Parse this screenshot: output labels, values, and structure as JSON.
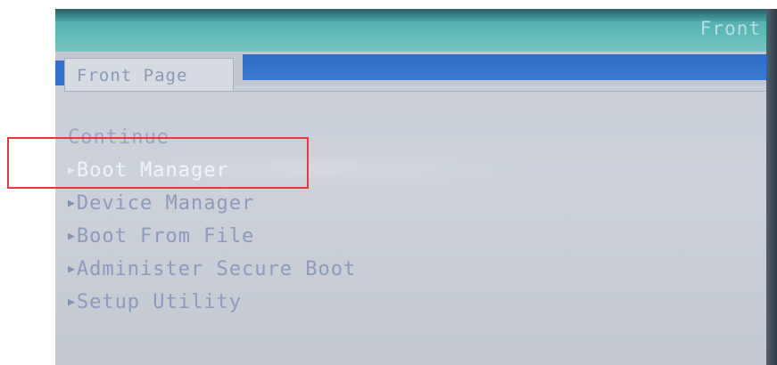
{
  "window": {
    "top_title": "Front"
  },
  "tabs": [
    {
      "label": "Front Page",
      "active": true
    }
  ],
  "menu": {
    "items": [
      {
        "label": "Continue",
        "has_arrow": false
      },
      {
        "label": "Boot Manager",
        "has_arrow": true,
        "selected": true
      },
      {
        "label": "Device Manager",
        "has_arrow": true
      },
      {
        "label": "Boot From File",
        "has_arrow": true
      },
      {
        "label": "Administer Secure Boot",
        "has_arrow": true
      },
      {
        "label": "Setup Utility",
        "has_arrow": true
      }
    ],
    "arrow_icon": "triangle-right-icon"
  },
  "colors": {
    "header_teal": "#5fb9b7",
    "tab_bar_blue": "#3472c9",
    "background": "#c7cdd6",
    "menu_text": "#8e9bbb",
    "selected_text": "#f1f3f8",
    "annotation_box": "#e53a3a"
  }
}
